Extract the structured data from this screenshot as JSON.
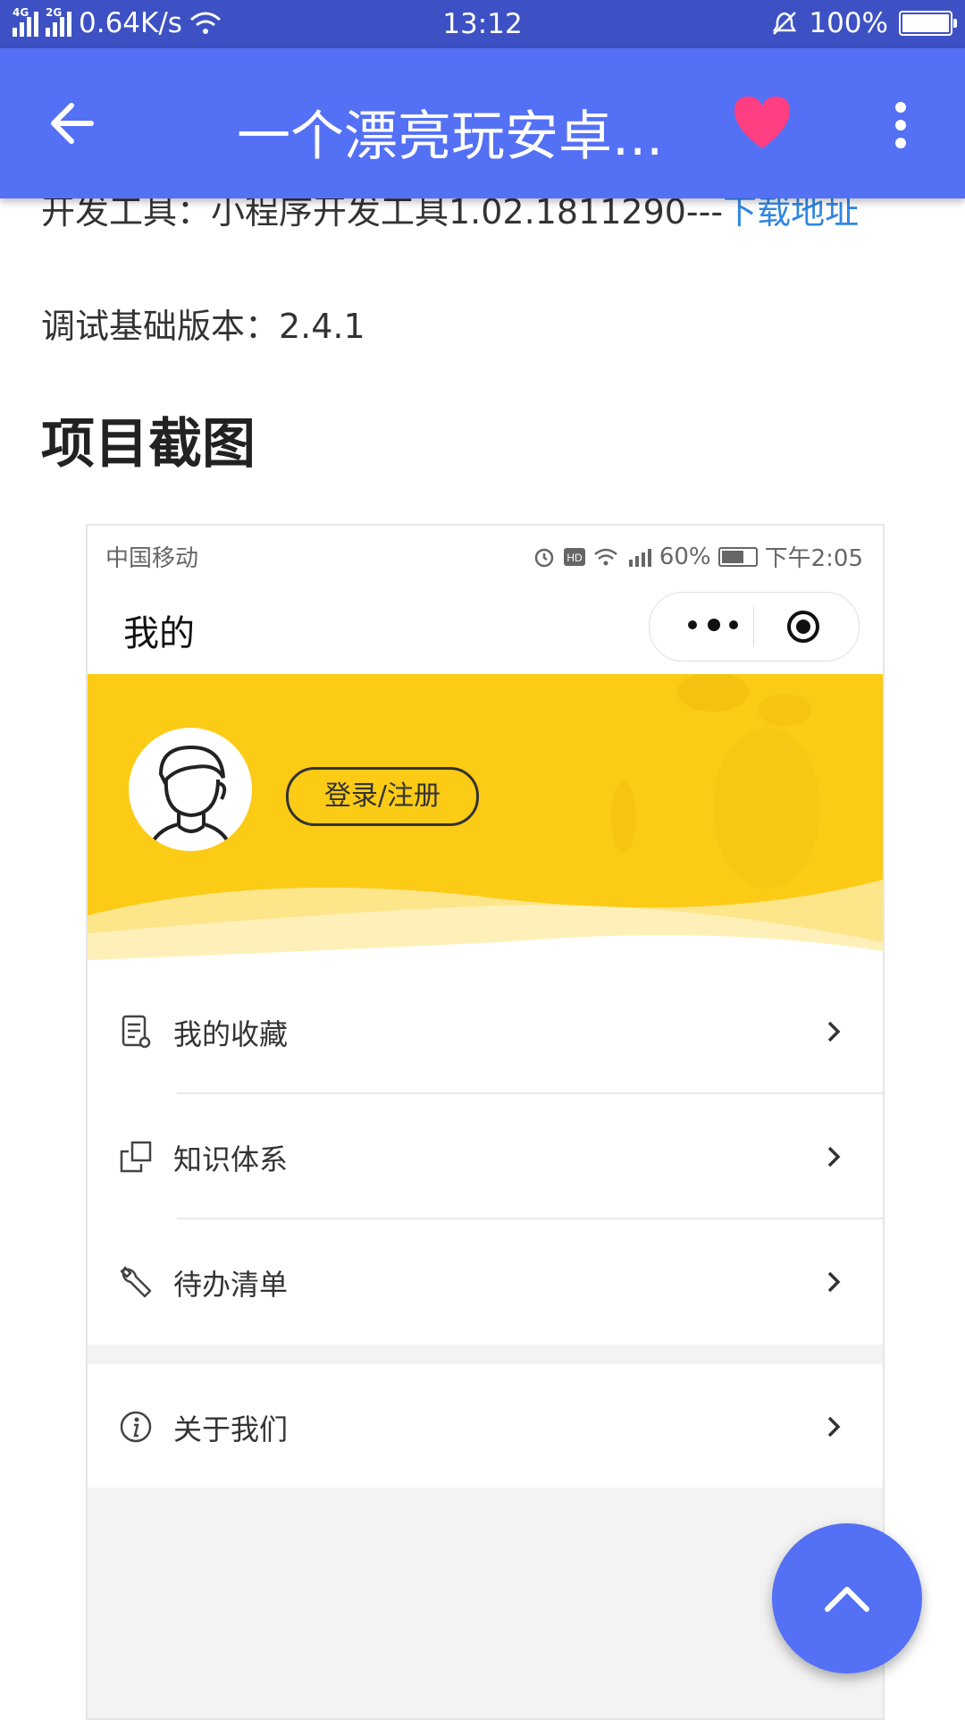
{
  "status_bar": {
    "net_left": "4G",
    "net_right": "2G",
    "speed": "0.64K/s",
    "time": "13:12",
    "battery": "100%",
    "battery_level": 1.0
  },
  "app_bar": {
    "title": "一个漂亮玩安卓...",
    "back_icon": "arrow-left-icon",
    "favorite_icon": "heart-icon",
    "favorite_color": "#ff3f82",
    "more_icon": "more-vert-icon",
    "color": "#5470f5"
  },
  "article": {
    "dev_tools_label": "开发工具：小程序开发工具1.02.1811290---",
    "dev_tools_link": "下载地址",
    "debug_base_version": "调试基础版本：2.4.1",
    "section_title": "项目截图"
  },
  "embedded_screenshot": {
    "status": {
      "carrier": "中国移动",
      "signal": "60%",
      "time": "下午2:05"
    },
    "nav_title": "我的",
    "banner_color": "#fccb16",
    "login_button": "登录/注册",
    "menu_items": [
      {
        "label": "我的收藏",
        "icon": "document-icon"
      },
      {
        "label": "知识体系",
        "icon": "squares-icon"
      },
      {
        "label": "待办清单",
        "icon": "wrench-icon"
      }
    ],
    "menu_items_2": [
      {
        "label": "关于我们",
        "icon": "info-icon"
      }
    ]
  },
  "fab": {
    "icon": "chevron-up-icon"
  }
}
